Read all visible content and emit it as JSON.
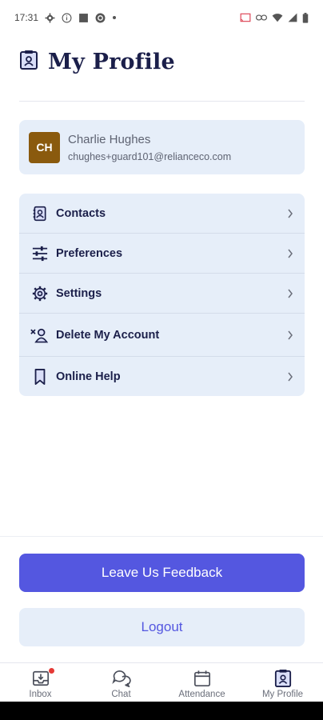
{
  "status_bar": {
    "time": "17:31",
    "icons_left": [
      "settings-icon",
      "info-icon",
      "square-app-icon",
      "gear-badge-icon",
      "dot-icon"
    ],
    "icons_right": [
      "cast-icon",
      "link-icon",
      "wifi-icon",
      "signal-icon",
      "battery-icon"
    ]
  },
  "header": {
    "title": "My Profile",
    "icon": "profile-badge-icon"
  },
  "profile": {
    "initials": "CH",
    "name": "Charlie Hughes",
    "email": "chughes+guard101@relianceco.com",
    "avatar_color": "#8a5a0e"
  },
  "menu": {
    "items": [
      {
        "label": "Contacts",
        "icon": "contacts-book-icon"
      },
      {
        "label": "Preferences",
        "icon": "sliders-icon"
      },
      {
        "label": "Settings",
        "icon": "gear-icon"
      },
      {
        "label": "Delete My Account",
        "icon": "delete-user-icon"
      },
      {
        "label": "Online Help",
        "icon": "bookmark-icon"
      }
    ]
  },
  "actions": {
    "feedback_label": "Leave Us Feedback",
    "logout_label": "Logout"
  },
  "bottom_nav": {
    "items": [
      {
        "label": "Inbox",
        "icon": "inbox-icon",
        "badge": true
      },
      {
        "label": "Chat",
        "icon": "chat-icon",
        "badge": false
      },
      {
        "label": "Attendance",
        "icon": "calendar-icon",
        "badge": false
      },
      {
        "label": "My Profile",
        "icon": "profile-badge-icon",
        "badge": false,
        "active": true
      }
    ]
  },
  "colors": {
    "primary": "#5457e0",
    "navy": "#1b1f4a",
    "card_bg": "#e6eef9",
    "badge_red": "#e53935"
  }
}
